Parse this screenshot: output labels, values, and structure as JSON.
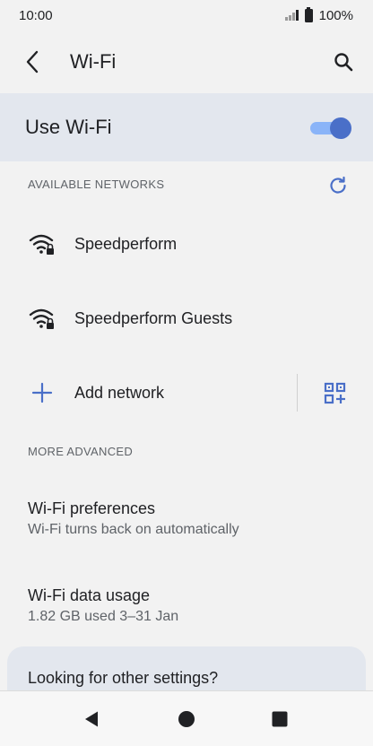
{
  "status_bar": {
    "time": "10:00",
    "battery": "100%"
  },
  "app_bar": {
    "title": "Wi-Fi"
  },
  "master_toggle": {
    "label": "Use Wi-Fi",
    "on": true
  },
  "sections": {
    "available": "AVAILABLE NETWORKS",
    "advanced": "MORE ADVANCED"
  },
  "networks": [
    {
      "ssid": "Speedperform",
      "secured": true
    },
    {
      "ssid": "Speedperform Guests",
      "secured": true
    }
  ],
  "add_network": {
    "label": "Add network"
  },
  "preferences": {
    "title": "Wi-Fi preferences",
    "subtitle": "Wi-Fi turns back on automatically"
  },
  "data_usage": {
    "title": "Wi-Fi data usage",
    "subtitle": "1.82 GB used 3–31 Jan"
  },
  "card": {
    "title": "Looking for other settings?"
  },
  "colors": {
    "accent": "#4a6fc8",
    "accent_light": "#8ab4f8",
    "highlight_bg": "#e3e7ee",
    "background": "#f2f2f2"
  },
  "icons": [
    "back-arrow-icon",
    "search-icon",
    "refresh-icon",
    "wifi-lock-icon",
    "plus-icon",
    "qr-code-icon",
    "nav-back-icon",
    "nav-home-icon",
    "nav-recents-icon"
  ]
}
